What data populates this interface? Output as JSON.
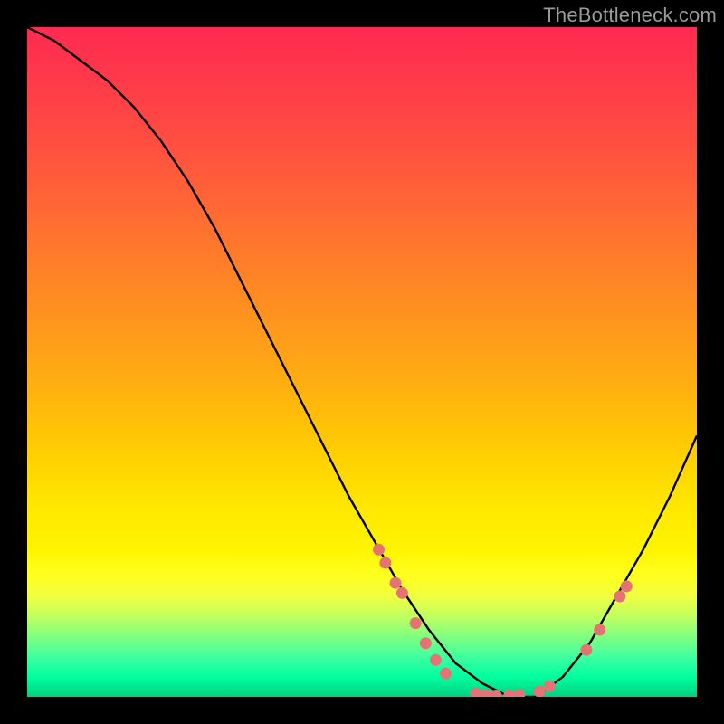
{
  "attribution": "TheBottleneck.com",
  "chart_data": {
    "type": "line",
    "title": "",
    "xlabel": "",
    "ylabel": "",
    "ylim": [
      0,
      100
    ],
    "xlim": [
      0,
      100
    ],
    "series": [
      {
        "name": "curve",
        "x": [
          0,
          4,
          8,
          12,
          16,
          20,
          24,
          28,
          32,
          36,
          40,
          44,
          48,
          52,
          56,
          60,
          64,
          68,
          72,
          76,
          80,
          84,
          88,
          92,
          96,
          100
        ],
        "y": [
          100,
          98,
          95,
          92,
          88,
          83,
          77,
          70,
          62,
          54,
          46,
          38,
          30,
          23,
          16,
          10,
          5,
          2,
          0,
          0,
          3,
          8,
          15,
          22,
          30,
          39
        ]
      }
    ],
    "markers": [
      {
        "x": 52.5,
        "y": 22
      },
      {
        "x": 53.5,
        "y": 20
      },
      {
        "x": 55.0,
        "y": 17
      },
      {
        "x": 56.0,
        "y": 15.5
      },
      {
        "x": 58.0,
        "y": 11
      },
      {
        "x": 59.5,
        "y": 8
      },
      {
        "x": 61.0,
        "y": 5.5
      },
      {
        "x": 62.5,
        "y": 3.5
      },
      {
        "x": 67.0,
        "y": 0.5
      },
      {
        "x": 68.5,
        "y": 0.3
      },
      {
        "x": 70.0,
        "y": 0.2
      },
      {
        "x": 72.0,
        "y": 0.2
      },
      {
        "x": 73.5,
        "y": 0.3
      },
      {
        "x": 76.5,
        "y": 0.8
      },
      {
        "x": 78.0,
        "y": 1.6
      },
      {
        "x": 83.5,
        "y": 7
      },
      {
        "x": 85.5,
        "y": 10
      },
      {
        "x": 88.5,
        "y": 15
      },
      {
        "x": 89.5,
        "y": 16.5
      }
    ],
    "marker_color": "#e57373",
    "curve_color": "#000000"
  }
}
